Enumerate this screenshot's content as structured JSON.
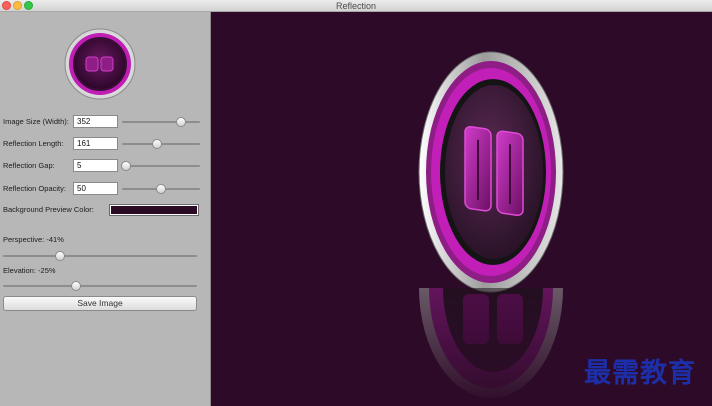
{
  "window": {
    "title": "Reflection"
  },
  "controls": {
    "image_size": {
      "label": "Image Size (Width):",
      "value": "352",
      "slider_fraction": 0.75
    },
    "reflection_length": {
      "label": "Reflection Length:",
      "value": "161",
      "slider_fraction": 0.45
    },
    "reflection_gap": {
      "label": "Reflection Gap:",
      "value": "5",
      "slider_fraction": 0.05
    },
    "reflection_opacity": {
      "label": "Reflection Opacity:",
      "value": "50",
      "slider_fraction": 0.5
    },
    "background_preview_color": {
      "label": "Background Preview Color:",
      "color": "#2a0a24"
    },
    "perspective": {
      "label": "Perspective: -41%",
      "value_percent": -41
    },
    "elevation": {
      "label": "Elevation: -25%",
      "value_percent": -25
    },
    "save_button": {
      "label": "Save Image"
    }
  },
  "watermark": {
    "text": "最需教育"
  },
  "colors": {
    "accent": "#c21fb8",
    "sidebar": "#b7b7b7",
    "preview_bg": "#2d0b28"
  }
}
